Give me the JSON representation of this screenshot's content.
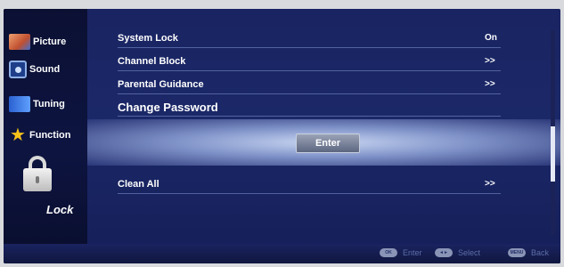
{
  "sidebar": {
    "items": [
      {
        "label": "Picture",
        "icon": "picture-icon"
      },
      {
        "label": "Sound",
        "icon": "sound-icon"
      },
      {
        "label": "Tuning",
        "icon": "tuning-icon"
      },
      {
        "label": "Function",
        "icon": "star-icon"
      }
    ],
    "active_label": "Lock"
  },
  "menu": {
    "rows": [
      {
        "label": "System Lock",
        "value": "On"
      },
      {
        "label": "Channel Block",
        "value": ">>"
      },
      {
        "label": "Parental Guidance",
        "value": ">>"
      },
      {
        "label": "Change Password",
        "value": ""
      },
      {
        "label": "Clean All",
        "value": ">>"
      }
    ],
    "enter_button": "Enter"
  },
  "footer": {
    "hints": [
      {
        "label": "Enter",
        "key": "OK"
      },
      {
        "label": "Select",
        "key": "◄►"
      },
      {
        "label": "Back",
        "key": "MENU"
      }
    ]
  },
  "colors": {
    "background": "#131b52",
    "highlight": "#c8d6f2",
    "text": "#ffffff",
    "hint_text": "#5d6ea8"
  }
}
